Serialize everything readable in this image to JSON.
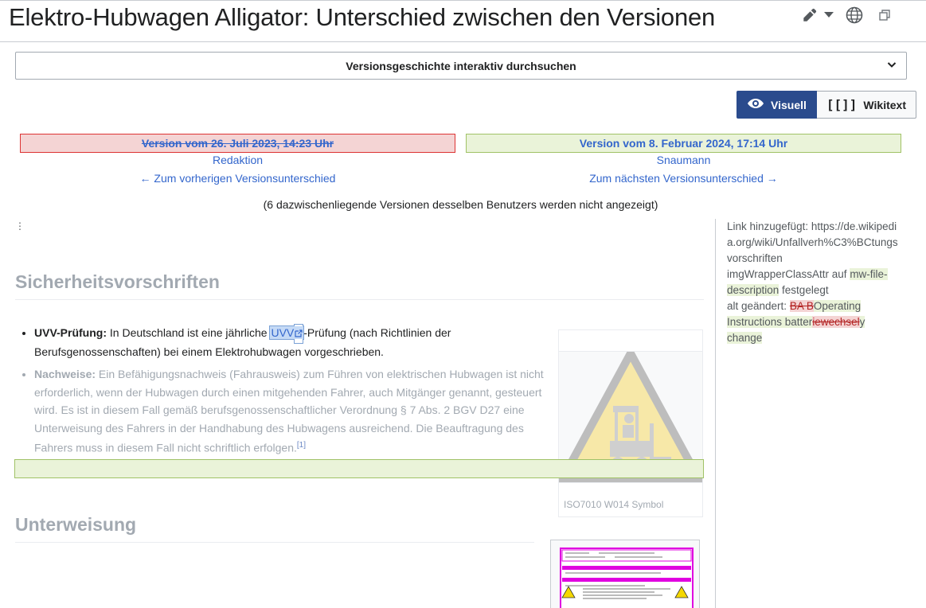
{
  "header": {
    "title": "Elektro-Hubwagen Alligator: Unterschied zwischen den Versionen"
  },
  "history": {
    "label": "Versionsgeschichte interaktiv durchsuchen"
  },
  "view_toggle": {
    "visual_label": "Visuell",
    "wikitext_label": "Wikitext"
  },
  "diff": {
    "old": {
      "version": "Version vom 26. Juli 2023, 14:23 Uhr",
      "user": "Redaktion",
      "nav": "← Zum vorherigen Versionsunterschied"
    },
    "new": {
      "version": "Version vom 8. Februar 2024, 17:14 Uhr",
      "user": "Snaumann",
      "nav": "Zum nächsten Versionsunterschied →"
    },
    "notice": "(6 dazwischenliegende Versionen desselben Benutzers werden nicht angezeigt)"
  },
  "content": {
    "dots": "⋮",
    "section1": "Sicherheitsvorschriften",
    "item1": {
      "term": "UVV-Prüfung:",
      "pre": " In Deutschland ist eine jährliche ",
      "link": "UVV",
      "post": "-Prüfung (nach Richtlinien der Berufsgenossenschaften) bei einem Elektrohubwagen vorgeschrieben."
    },
    "item2": {
      "term": "Nachweise:",
      "text": " Ein Befähigungsnachweis (Fahrausweis) zum Führen von elektrischen Hubwagen ist nicht erforderlich, wenn der Hubwagen durch einen mitgehenden Fahrer, auch Mitgänger genannt, gesteuert wird. Es ist in diesem Fall gemäß berufsgenossenschaftlicher Verordnung § 7 Abs. 2 BGV D27 eine Unterweisung des Fahrers in der Handhabung des Hubwagens ausreichend. Die Beauftragung des Fahrers muss in diesem Fall nicht schriftlich erfolgen.",
      "ref": "[1]"
    },
    "image_caption": "ISO7010 W014 Symbol",
    "section2": "Unterweisung"
  },
  "sidebar": {
    "line1": "Link hinzugefügt: https://de.wikipedia.org/wiki/Unfallverh%C3%BCtungsvorschriften",
    "line2_pre": "imgWrapperClassAttr auf ",
    "line2_val": "mw-file-description",
    "line2_post": " festgelegt",
    "line3_pre": "alt geändert: ",
    "line3_del1": "BA B",
    "line3_add1": "Operating Instructions",
    "line3_mid": " batter",
    "line3_del2": "iewechsel",
    "line3_add2": "y change"
  },
  "icons": [
    "edit-pencil-icon",
    "dropdown-arrow-icon",
    "language-globe-icon",
    "restore-window-icon",
    "chevron-down-icon",
    "eye-icon",
    "wikitext-brackets-icon",
    "external-link-icon"
  ],
  "colors": {
    "link": "#3366cc",
    "toggle_active": "#2a4b8d",
    "deleted_bg": "#f4d4d4",
    "added_bg": "#eaf3d9"
  }
}
